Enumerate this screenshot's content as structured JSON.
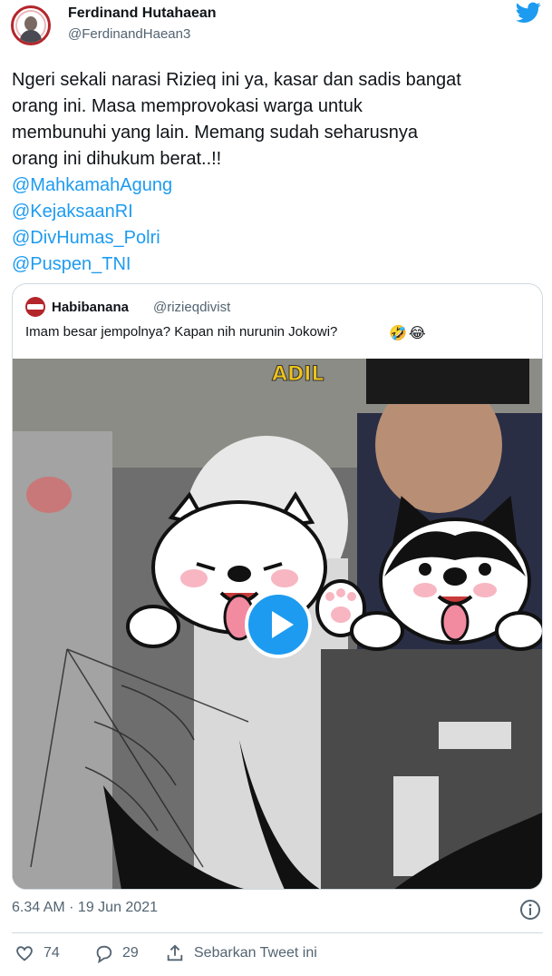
{
  "author": {
    "name": "Ferdinand Hutahaean",
    "handle": "@FerdinandHaean3",
    "avatar_icon": "profile-photo-icon"
  },
  "brand": {
    "logo_icon": "twitter-bird-icon",
    "color": "#1d9bf0"
  },
  "tweet": {
    "lines": [
      "Ngeri sekali narasi Rizieq ini ya, kasar dan sadis bangat",
      "orang ini. Masa memprovokasi warga untuk",
      "membunuhi yang lain. Memang sudah seharusnya",
      "orang ini dihukum berat..!!"
    ],
    "mentions": [
      "@MahkamahAgung",
      "@KejaksaanRI",
      "@DivHumas_Polri",
      "@Puspen_TNI"
    ]
  },
  "quoted": {
    "name": "Habibanana",
    "handle": "@rizieqdivist",
    "text": "Imam besar jempolnya? Kapan nih nurunin Jokowi?",
    "emojis": [
      "🤣",
      "😂"
    ],
    "media": {
      "type": "video",
      "overlay_text": "ADIL",
      "play_icon": "play-icon"
    }
  },
  "meta": {
    "timestamp": "6.34 AM · 19 Jun 2021",
    "info_icon": "info-icon"
  },
  "actions": {
    "likes": "74",
    "replies": "29",
    "share_label": "Sebarkan Tweet ini"
  },
  "colors": {
    "text": "#0f1419",
    "secondary": "#536471",
    "link": "#1d9bf0",
    "border": "#cfd9de"
  }
}
